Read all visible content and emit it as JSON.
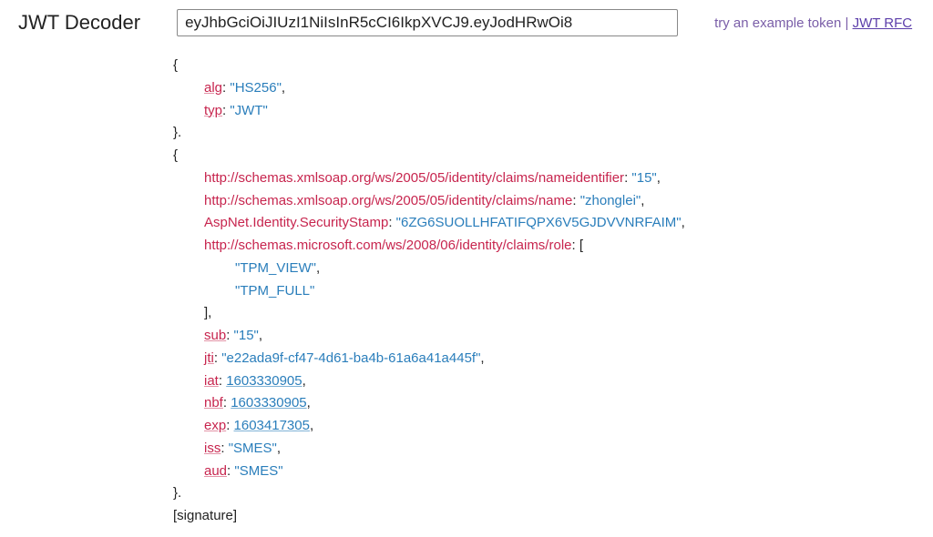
{
  "title": "JWT Decoder",
  "inputValue": "eyJhbGciOiJIUzI1NiIsInR5cCI6IkpXVCJ9.eyJodHRwOi8",
  "exampleText": "try an example token",
  "pipe": " | ",
  "rfcText": "JWT RFC",
  "header": {
    "alg": {
      "key": "alg",
      "value": "\"HS256\""
    },
    "typ": {
      "key": "typ",
      "value": "\"JWT\""
    }
  },
  "payload": {
    "nameid": {
      "key": "http://schemas.xmlsoap.org/ws/2005/05/identity/claims/nameidentifier",
      "value": "\"15\""
    },
    "name": {
      "key": "http://schemas.xmlsoap.org/ws/2005/05/identity/claims/name",
      "value": "\"zhonglei\""
    },
    "stamp": {
      "key": "AspNet.Identity.SecurityStamp",
      "value": "\"6ZG6SUOLLHFATIFQPX6V5GJDVVNRFAIM\""
    },
    "role": {
      "key": "http://schemas.microsoft.com/ws/2008/06/identity/claims/role",
      "values": [
        "\"TPM_VIEW\"",
        "\"TPM_FULL\""
      ]
    },
    "sub": {
      "key": "sub",
      "value": "\"15\""
    },
    "jti": {
      "key": "jti",
      "value": "\"e22ada9f-cf47-4d61-ba4b-61a6a41a445f\""
    },
    "iat": {
      "key": "iat",
      "value": "1603330905"
    },
    "nbf": {
      "key": "nbf",
      "value": "1603330905"
    },
    "exp": {
      "key": "exp",
      "value": "1603417305"
    },
    "iss": {
      "key": "iss",
      "value": "\"SMES\""
    },
    "aud": {
      "key": "aud",
      "value": "\"SMES\""
    }
  },
  "signatureLabel": "[signature]",
  "punct": {
    "openBrace": "{",
    "closeBraceDot": "}.",
    "closeBrace": "}",
    "openBracket": "[",
    "closeBracket": "]",
    "closeBracketComma": "],",
    "colon": ": ",
    "comma": ","
  }
}
